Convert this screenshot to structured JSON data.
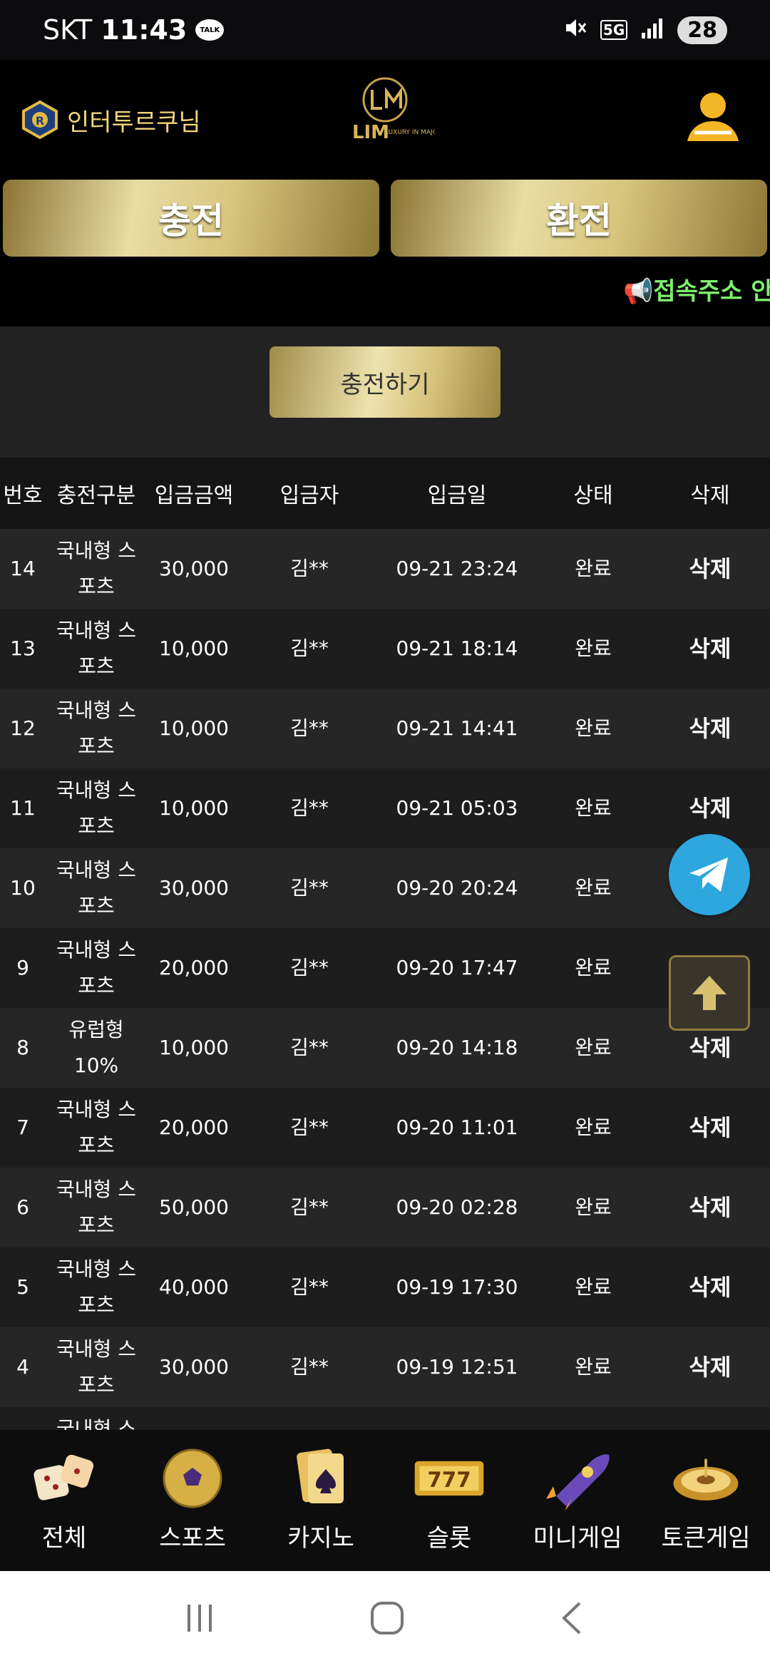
{
  "status_bar": {
    "carrier": "SKT",
    "time": "11:43",
    "talk_badge": "TALK",
    "network": "5G",
    "battery": "28"
  },
  "header": {
    "username": "인터투르쿠님",
    "logo_text": "LIM",
    "logo_sub": "LUXURY IN MAJOR"
  },
  "buttons": {
    "charge": "충전",
    "exchange": "환전",
    "charge_go": "충전하기"
  },
  "notice": {
    "text": "📢접속주소 안"
  },
  "table": {
    "columns": [
      "번호",
      "충전구분",
      "입금금액",
      "입금자",
      "입금일",
      "상태",
      "삭제"
    ],
    "rows": [
      {
        "no": "14",
        "type": "국내형 스포츠",
        "amount": "30,000",
        "depositor": "김**",
        "date": "09-21 23:24",
        "status": "완료",
        "delete": "삭제"
      },
      {
        "no": "13",
        "type": "국내형 스포츠",
        "amount": "10,000",
        "depositor": "김**",
        "date": "09-21 18:14",
        "status": "완료",
        "delete": "삭제"
      },
      {
        "no": "12",
        "type": "국내형 스포츠",
        "amount": "10,000",
        "depositor": "김**",
        "date": "09-21 14:41",
        "status": "완료",
        "delete": "삭제"
      },
      {
        "no": "11",
        "type": "국내형 스포츠",
        "amount": "10,000",
        "depositor": "김**",
        "date": "09-21 05:03",
        "status": "완료",
        "delete": "삭제"
      },
      {
        "no": "10",
        "type": "국내형 스포츠",
        "amount": "30,000",
        "depositor": "김**",
        "date": "09-20 20:24",
        "status": "완료",
        "delete": ""
      },
      {
        "no": "9",
        "type": "국내형 스포츠",
        "amount": "20,000",
        "depositor": "김**",
        "date": "09-20 17:47",
        "status": "완료",
        "delete": ""
      },
      {
        "no": "8",
        "type": "유럽형 10%",
        "amount": "10,000",
        "depositor": "김**",
        "date": "09-20 14:18",
        "status": "완료",
        "delete": "삭제"
      },
      {
        "no": "7",
        "type": "국내형 스포츠",
        "amount": "20,000",
        "depositor": "김**",
        "date": "09-20 11:01",
        "status": "완료",
        "delete": "삭제"
      },
      {
        "no": "6",
        "type": "국내형 스포츠",
        "amount": "50,000",
        "depositor": "김**",
        "date": "09-20 02:28",
        "status": "완료",
        "delete": "삭제"
      },
      {
        "no": "5",
        "type": "국내형 스포츠",
        "amount": "40,000",
        "depositor": "김**",
        "date": "09-19 17:30",
        "status": "완료",
        "delete": "삭제"
      },
      {
        "no": "4",
        "type": "국내형 스포츠",
        "amount": "30,000",
        "depositor": "김**",
        "date": "09-19 12:51",
        "status": "완료",
        "delete": "삭제"
      },
      {
        "no": "",
        "type": "국내형 스포",
        "amount": "",
        "depositor": "",
        "date": "",
        "status": "",
        "delete": ""
      }
    ]
  },
  "bottom_nav": [
    {
      "label": "전체",
      "icon": "dice-icon"
    },
    {
      "label": "스포츠",
      "icon": "soccer-ball-icon"
    },
    {
      "label": "카지노",
      "icon": "cards-icon"
    },
    {
      "label": "슬롯",
      "icon": "slot-777-icon"
    },
    {
      "label": "미니게임",
      "icon": "rocket-icon"
    },
    {
      "label": "토큰게임",
      "icon": "roulette-icon"
    }
  ],
  "colors": {
    "gold": "#d8c57c",
    "notice_green": "#7ef06c",
    "username_gold": "#f2d67a",
    "telegram_blue": "#2ea6de"
  }
}
